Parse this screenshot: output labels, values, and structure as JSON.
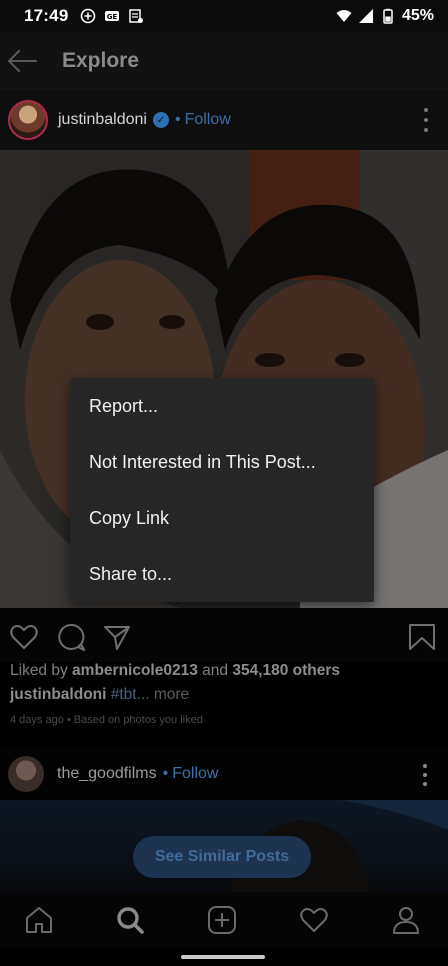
{
  "status_bar": {
    "time": "17:49",
    "battery": "45%",
    "icons_left": [
      "circle-plus-icon",
      "ge-icon",
      "carrier-icon"
    ],
    "icons_right": [
      "wifi-icon",
      "signal-icon",
      "battery-icon"
    ]
  },
  "header": {
    "title": "Explore"
  },
  "post": {
    "username": "justinbaldoni",
    "separator": "•",
    "follow_label": "Follow",
    "liked_by_prefix": "Liked by",
    "liked_by_user": "ambernicole0213",
    "liked_by_and": "and",
    "liked_by_others": "354,180 others",
    "caption_user": "justinbaldoni",
    "caption_hashtag": "#tbt",
    "caption_more": "... more",
    "meta": "4 days ago • Based on photos you liked"
  },
  "menu": {
    "items": [
      {
        "label": "Report..."
      },
      {
        "label": "Not Interested in This Post..."
      },
      {
        "label": "Copy Link"
      },
      {
        "label": "Share to..."
      }
    ]
  },
  "post2": {
    "username": "the_goodfilms",
    "separator": "•",
    "follow_label": "Follow",
    "similar_button": "See Similar Posts"
  },
  "bottom_nav": {
    "items": [
      "home-icon",
      "search-icon",
      "new-post-icon",
      "activity-icon",
      "profile-icon"
    ]
  },
  "colors": {
    "accent_blue": "#3d6fa4",
    "menu_bg": "#262626",
    "background": "#000000"
  }
}
